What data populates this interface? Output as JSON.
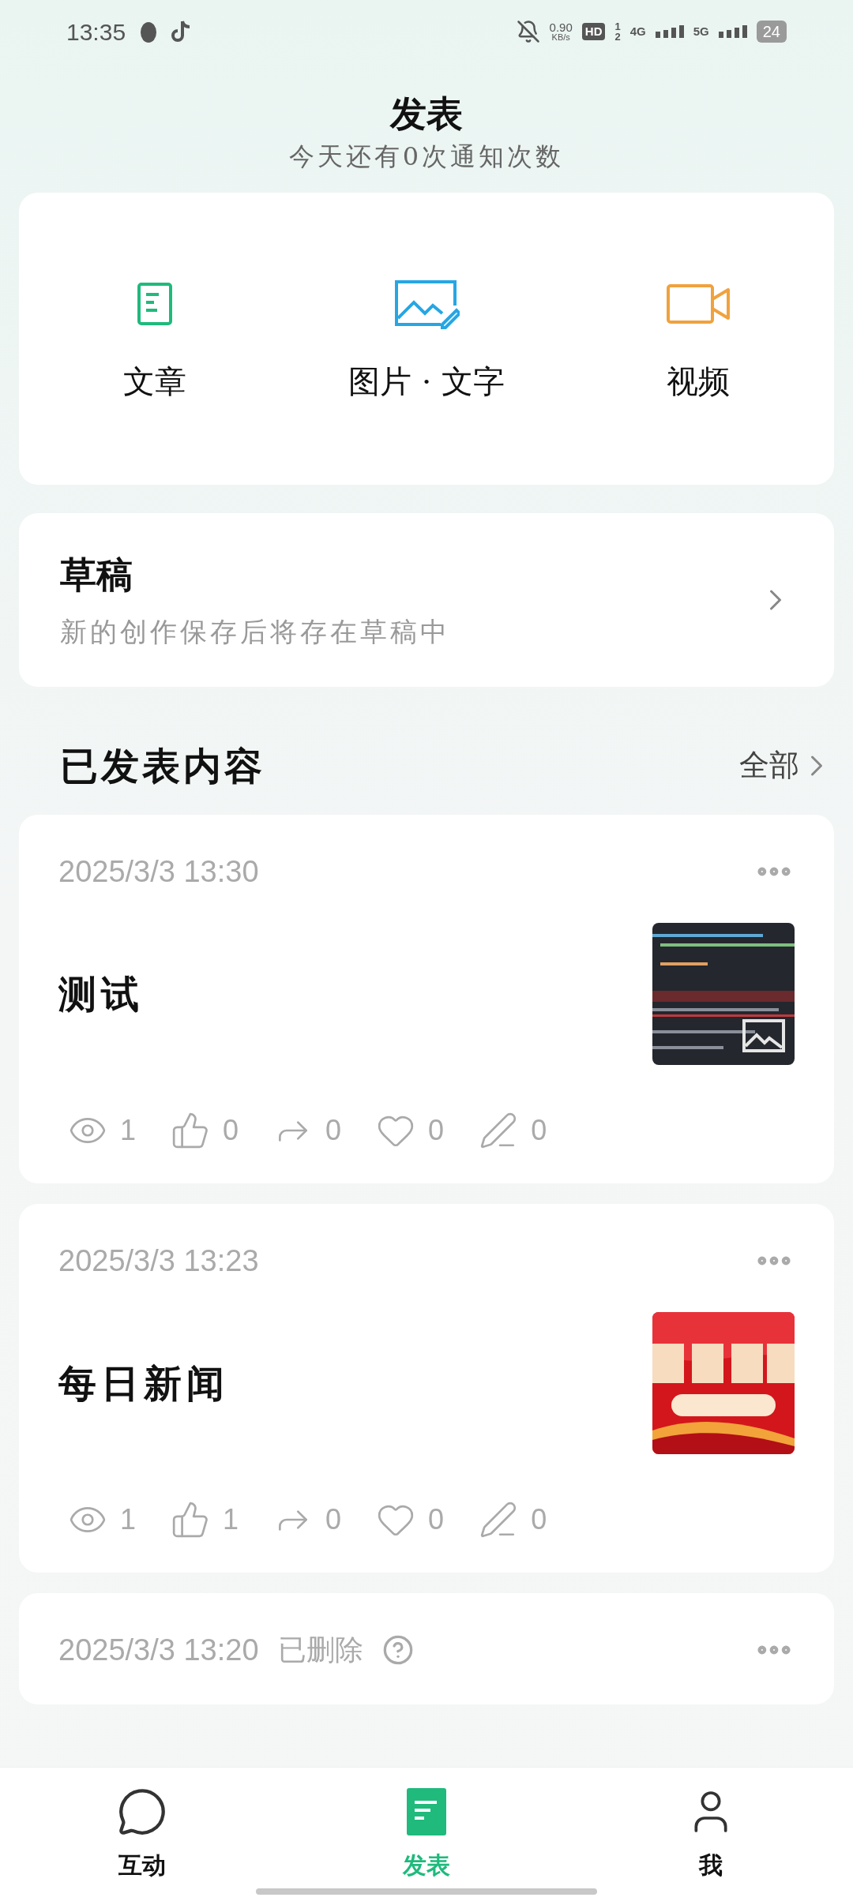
{
  "status_bar": {
    "time": "13:35",
    "net_speed": "0.90",
    "net_unit": "KB/s",
    "hd": "HD",
    "sim_1": "1",
    "sim_2": "2",
    "net_4g": "4G",
    "net_5g": "5G",
    "battery": "24"
  },
  "header": {
    "title": "发表",
    "subtitle": "今天还有0次通知次数"
  },
  "create_options": [
    {
      "kind": "article",
      "label": "文章"
    },
    {
      "kind": "image_text",
      "label": "图片 · 文字"
    },
    {
      "kind": "video",
      "label": "视频"
    }
  ],
  "drafts": {
    "title": "草稿",
    "subtitle": "新的创作保存后将存在草稿中"
  },
  "published": {
    "title": "已发表内容",
    "all_link": "全部",
    "posts": [
      {
        "date": "2025/3/3 13:30",
        "title": "测试",
        "stats": [
          {
            "kind": "views",
            "value": "1"
          },
          {
            "kind": "likes",
            "value": "0"
          },
          {
            "kind": "shares",
            "value": "0"
          },
          {
            "kind": "favorites",
            "value": "0"
          },
          {
            "kind": "comments",
            "value": "0"
          }
        ]
      },
      {
        "date": "2025/3/3 13:23",
        "title": "每日新闻",
        "stats": [
          {
            "kind": "views",
            "value": "1"
          },
          {
            "kind": "likes",
            "value": "1"
          },
          {
            "kind": "shares",
            "value": "0"
          },
          {
            "kind": "favorites",
            "value": "0"
          },
          {
            "kind": "comments",
            "value": "0"
          }
        ]
      },
      {
        "date": "2025/3/3 13:20",
        "status": "已删除"
      }
    ]
  },
  "tabs": [
    {
      "kind": "interact",
      "label": "互动",
      "selected": false
    },
    {
      "kind": "publish",
      "label": "发表",
      "selected": true
    },
    {
      "kind": "me",
      "label": "我",
      "selected": false
    }
  ]
}
